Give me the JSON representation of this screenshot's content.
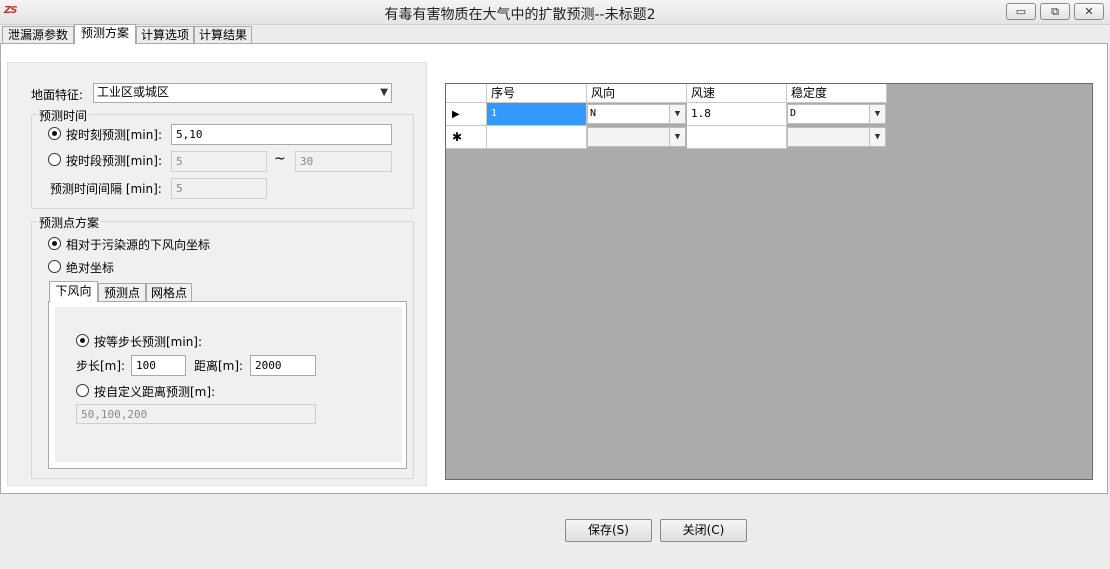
{
  "window": {
    "title": "有毒有害物质在大气中的扩散预测--未标题2",
    "icon_text": "ZS",
    "minimize": "▭",
    "restore": "⧉",
    "close": "✕"
  },
  "tabs": [
    "泄漏源参数",
    "预测方案",
    "计算选项",
    "计算结果"
  ],
  "left": {
    "surface_label": "地面特征:",
    "surface_value": "工业区或城区",
    "time_group_title": "预测时间",
    "by_moment_label": "按时刻预测[min]:",
    "by_moment_value": "5,10",
    "by_period_label": "按时段预测[min]:",
    "period_from": "5",
    "period_tilde": "~",
    "period_to": "30",
    "interval_label": "预测时间间隔 [min]:",
    "interval_value": "5",
    "point_group_title": "预测点方案",
    "relative_label": "相对于污染源的下风向坐标",
    "absolute_label": "绝对坐标",
    "inner_tabs": [
      "下风向",
      "预测点",
      "网格点"
    ],
    "equal_step_label": "按等步长预测[min]:",
    "step_label": "步长[m]:",
    "step_value": "100",
    "distance_label": "距离[m]:",
    "distance_value": "2000",
    "custom_label": "按自定义距离预测[m]:",
    "custom_value": "50,100,200"
  },
  "grid": {
    "headers": [
      "序号",
      "风向",
      "风速",
      "稳定度"
    ],
    "rows": [
      {
        "indicator": "▶",
        "index": "1",
        "direction": "N",
        "speed": "1.8",
        "stability": "D"
      },
      {
        "indicator": "✱",
        "index": "",
        "direction": "",
        "speed": "",
        "stability": ""
      }
    ]
  },
  "footer": {
    "save": "保存(S)",
    "close": "关闭(C)"
  }
}
